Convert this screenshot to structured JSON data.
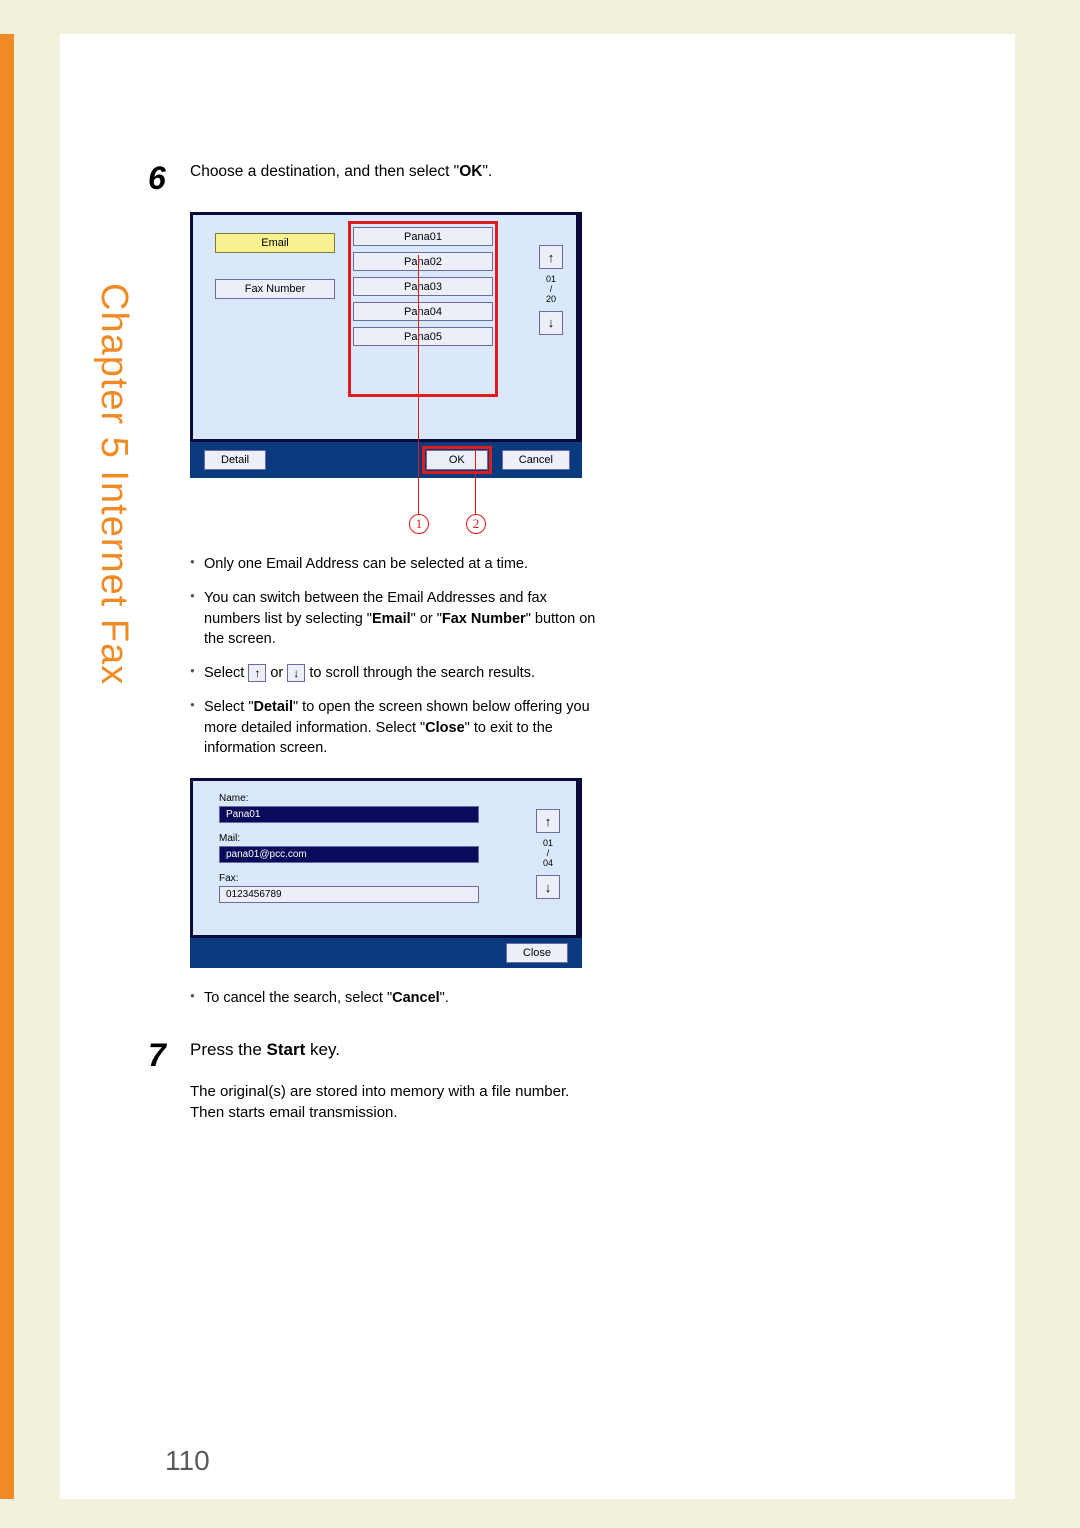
{
  "chapter": {
    "label": "Chapter 5   Internet Fax"
  },
  "page_number": "110",
  "step6": {
    "number": "6",
    "intro_a": "Choose a destination, and then select \"",
    "intro_bold": "OK",
    "intro_b": "\"."
  },
  "panel1": {
    "email_btn": "Email",
    "faxnum_btn": "Fax Number",
    "items": [
      "Pana01",
      "Pana02",
      "Pana03",
      "Pana04",
      "Pana05"
    ],
    "counter_top": "01",
    "counter_mid": "/",
    "counter_bot": "20",
    "detail_btn": "Detail",
    "ok_btn": "OK",
    "cancel_btn": "Cancel",
    "callout1": "1",
    "callout2": "2"
  },
  "bullets_a": {
    "li1": "Only one Email Address can be selected at a time.",
    "li2a": "You can switch between the Email Addresses and fax numbers list by selecting \"",
    "li2b1": "Email",
    "li2c": "\" or \"",
    "li2b2": "Fax Number",
    "li2d": "\" button on the screen.",
    "li3a": "Select ",
    "li3b": " or ",
    "li3c": " to scroll through the search results.",
    "li4a": "Select \"",
    "li4b1": "Detail",
    "li4c": "\" to open the screen shown below offering you more detailed information. Select \"",
    "li4b2": "Close",
    "li4d": "\" to exit to the information screen."
  },
  "panel2": {
    "name_lbl": "Name:",
    "name_val": "Pana01",
    "mail_lbl": "Mail:",
    "mail_val": "pana01@pcc.com",
    "fax_lbl": "Fax:",
    "fax_val": "0123456789",
    "counter_top": "01",
    "counter_mid": "/",
    "counter_bot": "04",
    "close_btn": "Close"
  },
  "bullets_b": {
    "li1a": "To cancel the search, select \"",
    "li1b": "Cancel",
    "li1c": "\"."
  },
  "step7": {
    "number": "7",
    "intro_a": "Press the ",
    "intro_bold": "Start",
    "intro_b": " key.",
    "body": "The original(s) are stored into memory with a file number. Then starts email transmission."
  }
}
